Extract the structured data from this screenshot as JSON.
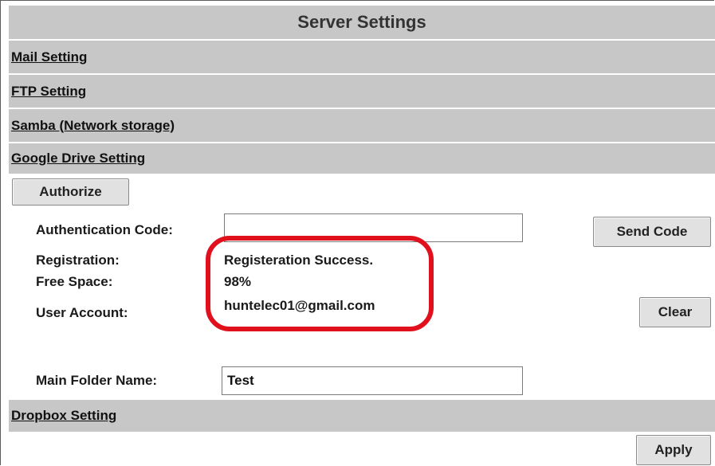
{
  "title": "Server Settings",
  "sections": {
    "mail": "Mail Setting",
    "ftp": "FTP Setting",
    "samba": "Samba (Network storage)",
    "gdrive": "Google Drive Setting",
    "dropbox": "Dropbox Setting"
  },
  "gdrive": {
    "authorize_label": "Authorize",
    "auth_code_label": "Authentication Code:",
    "auth_code_value": "",
    "send_code_label": "Send Code",
    "registration_label": "Registration:",
    "registration_value": "Registeration Success.",
    "free_space_label": "Free Space:",
    "free_space_value": "98%",
    "user_account_label": "User Account:",
    "user_account_value": "huntelec01@gmail.com",
    "clear_label": "Clear",
    "folder_label": "Main Folder Name:",
    "folder_value": "Test"
  },
  "apply_label": "Apply",
  "colors": {
    "section_bg": "#c7c7c7",
    "highlight": "#e0101c"
  }
}
